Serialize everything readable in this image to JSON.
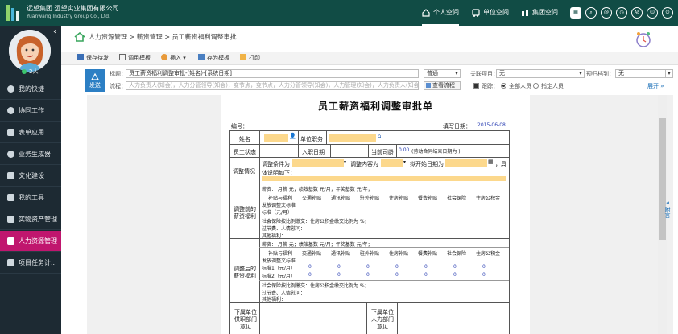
{
  "topbar": {
    "company_cn": "远望集团  远望实业集团有限公司",
    "company_en": "Yuanwang Industry Group Co., Ltd.",
    "tabs": [
      {
        "label": "个人空间",
        "icon": "home-icon"
      },
      {
        "label": "单位空间",
        "icon": "bus-icon"
      },
      {
        "label": "集团空间",
        "icon": "group-icon"
      }
    ],
    "a8_label": "A8"
  },
  "sidebar": {
    "online_count": "2人",
    "items": [
      {
        "label": "我的快捷",
        "icon": "plus-circle-icon"
      },
      {
        "label": "协同工作",
        "icon": "sync-icon"
      },
      {
        "label": "表单应用",
        "icon": "form-icon"
      },
      {
        "label": "业务生成器",
        "icon": "gear-icon"
      },
      {
        "label": "文化建设",
        "icon": "flag-icon"
      },
      {
        "label": "我的工具",
        "icon": "toolbox-icon"
      },
      {
        "label": "实物资产管理",
        "icon": "asset-icon"
      },
      {
        "label": "人力资源管理",
        "icon": "person-doc-icon"
      },
      {
        "label": "项目任务计...",
        "icon": "project-icon"
      }
    ],
    "active_index": 7
  },
  "breadcrumb": "人力资源管理 > 薪资管理 > 员工薪资福利调整审批",
  "toolbar": {
    "save_draft": "保存待发",
    "use_template": "调用模板",
    "insert": "插入",
    "save_template": "存为模板",
    "print": "打印"
  },
  "form": {
    "send_label": "发送",
    "title_label": "标题：",
    "title_value": "员工薪资福利调整审批-(姓名)-[系统日期]",
    "priority_value": "普通",
    "related_label": "关联项目：",
    "related_value": "无",
    "deadline_label": "预归档到：",
    "deadline_value": "无",
    "flow_label": "流程：",
    "flow_placeholder": "人力负责人(知会)，人力分管领导(知会)，变节点，变节点，人力分管领导(知会)，人力管理(知会)，人力负责人(知会)，(结束)",
    "view_flow": "查看流程",
    "track_label": "跟踪：",
    "all_people": "全部人员",
    "specified_people": "指定人员",
    "expand": "展开"
  },
  "doc": {
    "title": "员工薪资福利调整审批单",
    "number_label": "编号：",
    "fill_date_label": "填写日期：",
    "fill_date": "2015-06-08",
    "name_label": "姓名",
    "unit_job_label": "单位职务",
    "status_label": "员工状态",
    "entry_date_label": "入职日期",
    "current_age_label": "当前司龄",
    "age_value": "0.00",
    "age_note": "(劳动合同结束日期为 )",
    "adjust_label": "调整情况",
    "adjust_line1a": "调整条件为",
    "adjust_line1b": "调整内容为",
    "adjust_line1c": "拟开始日期为",
    "adjust_line1d": "，具",
    "adjust_line2": "体说明如下：",
    "before_label": "调整前的薪资福利",
    "after_label": "调整后的薪资福利",
    "salary_row": "薪资：  月薪   元；绩效基数   元/月；年奖基数   元/年；",
    "allowance_headers": [
      "补贴与福利",
      "交通补贴",
      "通讯补贴",
      "驻外补贴",
      "住房补贴",
      "餐费补贴",
      "社会保险",
      "住房公积金"
    ],
    "standard_row1": "发放调整文标准",
    "standard_row2": "标准（元/月）",
    "social_row": "社会保险按比例缴交：住房公积金缴交比例为  %；",
    "holiday_row": "过节费、人情慰问：",
    "other_row": "其他福利：",
    "salary_row2": "薪资：  月薪   元；绩效基数   元/月；年奖基数   元/年；",
    "std1_label": "标准1（元/月）",
    "std2_label": "标准2（元/月）",
    "zero": "0",
    "social_row2": "社会保险按比例缴交：住房公积金缴交比例为  %；",
    "holiday_row2": "过节费、人情慰问：",
    "other_row2": "其他福利：",
    "sub_unit_label": "下属单位供职部门意见",
    "sub_hr_label": "下属单位人力部门意见"
  },
  "right_pane": {
    "label": "附言"
  }
}
